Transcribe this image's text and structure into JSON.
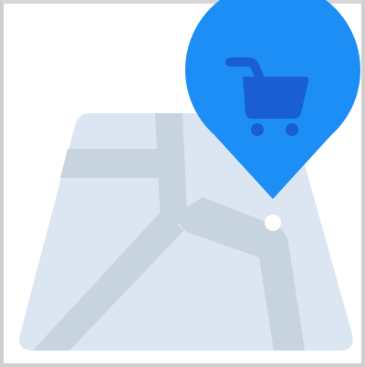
{
  "illustration": {
    "icon": "map-pin-shopping-cart",
    "map_icon": "folded-map",
    "pin_icon": "location-pin",
    "cart_icon": "shopping-cart"
  },
  "colors": {
    "frame_border": "#cfcfcf",
    "background": "#ffffff",
    "map_fill": "#dbe6f2",
    "map_roads": "#c7d3df",
    "pin_fill": "#1e8ef7",
    "pin_point_dot": "#ffffff",
    "cart_fill": "#1a5fd1"
  }
}
